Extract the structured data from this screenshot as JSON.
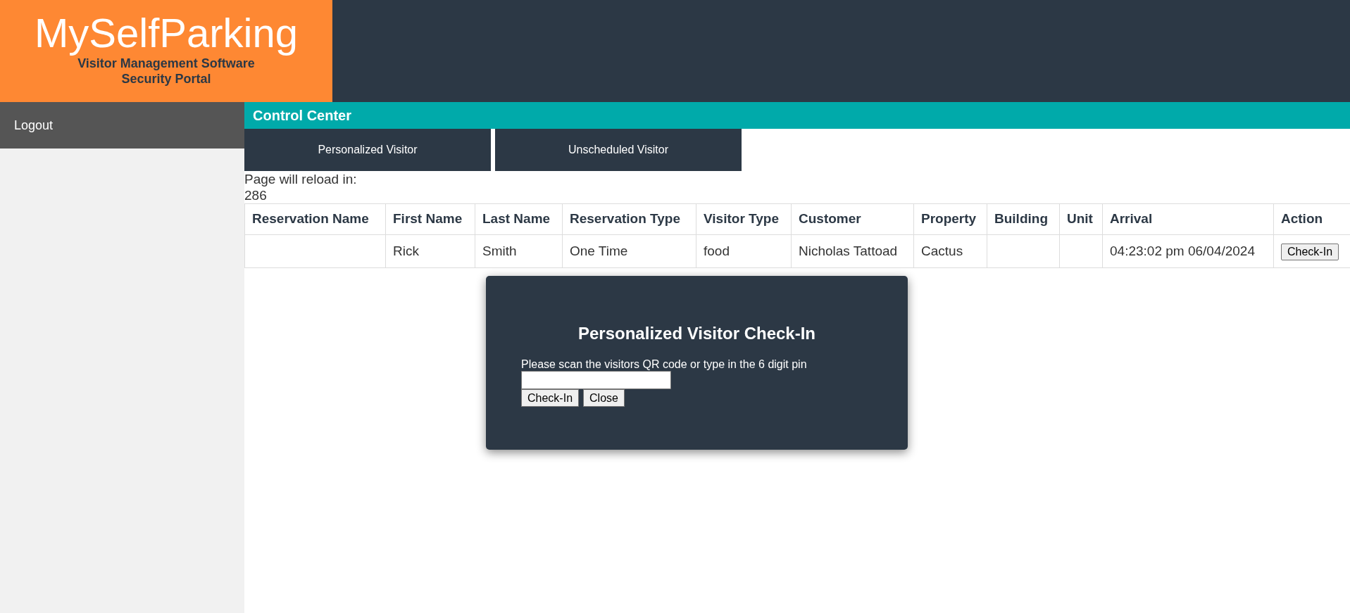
{
  "brand": {
    "title": "MySelfParking",
    "subtitle_lines": [
      "Visitor Management Software",
      "Security Portal"
    ]
  },
  "sidebar": {
    "items": [
      {
        "label": "Logout"
      }
    ]
  },
  "section_title": "Control Center",
  "tabs": [
    {
      "label": "Personalized Visitor"
    },
    {
      "label": "Unscheduled Visitor"
    }
  ],
  "reload": {
    "label": "Page will reload in:",
    "value": "286"
  },
  "table": {
    "columns": [
      "Reservation Name",
      "First Name",
      "Last Name",
      "Reservation Type",
      "Visitor Type",
      "Customer",
      "Property",
      "Building",
      "Unit",
      "Arrival",
      "Action"
    ],
    "rows": [
      {
        "cells": [
          "",
          "Rick",
          "Smith",
          "One Time",
          "food",
          "Nicholas Tattoad",
          "Cactus",
          "",
          "",
          "04:23:02 pm 06/04/2024"
        ],
        "action": "Check-In"
      }
    ]
  },
  "modal": {
    "title": "Personalized Visitor Check-In",
    "prompt": "Please scan the visitors QR code or type in the 6 digit pin",
    "buttons": [
      "Check-In",
      "Close"
    ]
  }
}
